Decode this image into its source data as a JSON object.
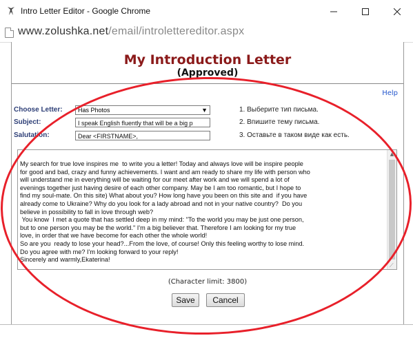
{
  "window": {
    "title": "Intro Letter Editor - Google Chrome",
    "minimize_icon": "minimize-icon",
    "maximize_icon": "maximize-icon",
    "close_icon": "close-icon"
  },
  "address": {
    "domain": "www.zolushka.net",
    "path": "/email/introlettereditor.aspx"
  },
  "page": {
    "title": "My Introduction Letter",
    "status": "(Approved)",
    "help_label": "Help"
  },
  "form": {
    "choose_letter": {
      "label": "Choose Letter:",
      "value": "Has Photos",
      "hint": "1. Выберите тип письма."
    },
    "subject": {
      "label": "Subject:",
      "value": "I speak English fluently that will be a big p",
      "hint": "2. Впишите тему письма."
    },
    "salutation": {
      "label": "Salutation:",
      "value": "Dear <FIRSTNAME>,",
      "hint": "3. Оставьте в таком виде как есть."
    },
    "letter_text": "My search for true love inspires me  to write you a letter! Today and always love will be inspire people\nfor good and bad, crazy and funny achievements. I want and am ready to share my life with person who\nwill understand me in everything will be waiting for our meet after work and we will spend a lot of\nevenings together just having desire of each other company. May be I am too romantic, but I hope to\nfind my soul-mate. On this site) What about you? How long have you been on this site and  if you have\nalready come to Ukraine? Why do you look for a lady abroad and not in your native country?  Do you\nbelieve in possibility to fall in love through web?\n You know  I met a quote that has settled deep in my mind: \"To the world you may be just one person,\nbut to one person you may be the world.\" I'm a big believer that. Therefore I am looking for my true\nlove, in order that we have become for each other the whole world!\nSo are you  ready to lose your head?...From the love, of course! Only this feeling worthy to lose mind.\nDo you agree with me? I'm looking forward to your reply!\nSincerely and warmly,Ekaterina!",
    "char_limit": "(Character limit: 3800)",
    "save_label": "Save",
    "cancel_label": "Cancel"
  },
  "annotation": {
    "color": "#e8202a"
  },
  "colors": {
    "title": "#8b1a1a",
    "labels": "#2e3f77",
    "link": "#2255cc"
  }
}
